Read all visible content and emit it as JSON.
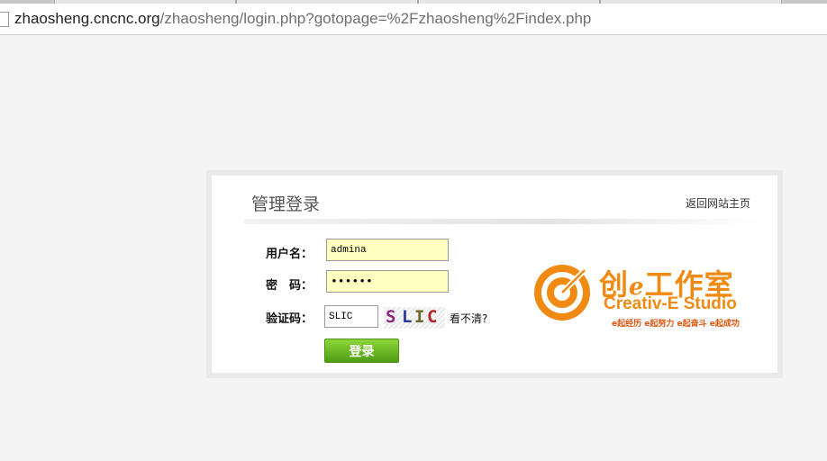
{
  "browser": {
    "url_host": "zhaosheng.cncnc.org",
    "url_path": "/zhaosheng/login.php?gotopage=%2Fzhaosheng%2Findex.php"
  },
  "login": {
    "title": "管理登录",
    "back_link": "返回网站主页",
    "username_label": "用户名：",
    "username_value": "admina",
    "password_label": "密　码：",
    "password_value": "••••••",
    "captcha_label": "验证码：",
    "captcha_value": "SLIC",
    "captcha_chars": [
      "S",
      "L",
      "I",
      "C"
    ],
    "captcha_colors": [
      "#8a2a7a",
      "#2a3a9a",
      "#6a6a2a",
      "#b8222a"
    ],
    "refresh_label": "看不清?",
    "submit_label": "登录"
  },
  "logo": {
    "cn_text_1": "创",
    "cn_text_e": "e",
    "cn_text_2": "工作室",
    "en_text": "Creativ-E Studio",
    "slogan": "e起经历 e起努力 e起奋斗 e起成功",
    "brand_color": "#f08a12"
  },
  "colors": {
    "submit_green": "#5aa918",
    "input_highlight": "#ffffc0"
  }
}
